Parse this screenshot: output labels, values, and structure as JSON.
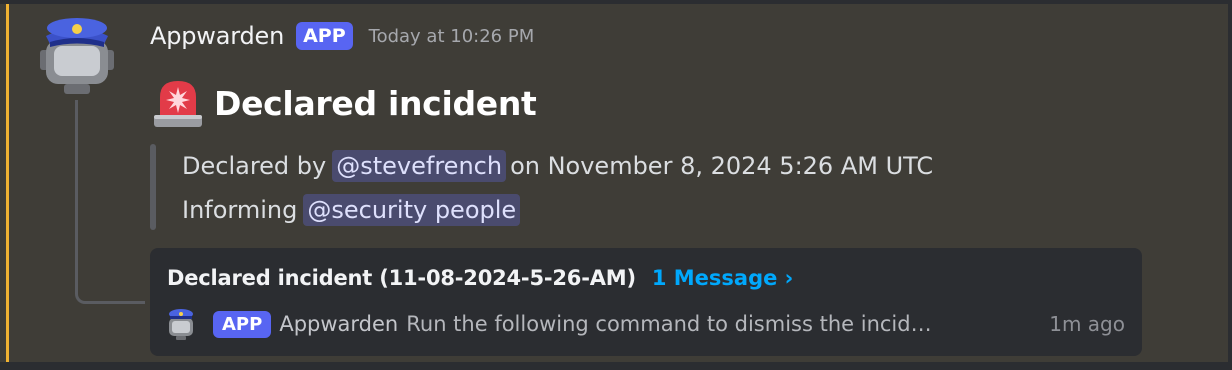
{
  "colors": {
    "highlight_bar": "#f0b232",
    "app_tag": "#5865f2",
    "mention_bg": "#4a4b6e",
    "link": "#00a8fc"
  },
  "message": {
    "author": "Appwarden",
    "app_tag": "APP",
    "timestamp": "Today at 10:26 PM",
    "avatar_icon": "police-bot-icon",
    "title_icon": "siren-icon",
    "title": "Declared incident",
    "quote": {
      "line1_prefix": "Declared by",
      "declared_by_mention": "@stevefrench",
      "line1_suffix": "on November 8, 2024 5:26 AM UTC",
      "line2_prefix": "Informing",
      "informing_mention": "@security people"
    }
  },
  "thread": {
    "name": "Declared incident (11-08-2024-5-26-AM)",
    "message_count": "1 Message ›",
    "preview_app_tag": "APP",
    "preview_author": "Appwarden",
    "preview_text": "Run the following command to dismiss the incid…",
    "preview_time": "1m ago"
  }
}
